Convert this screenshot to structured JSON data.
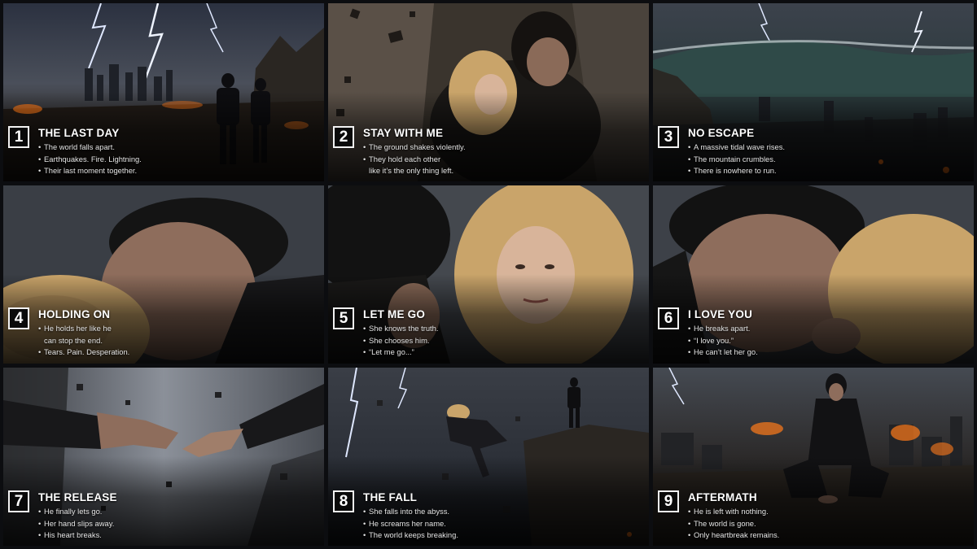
{
  "panels": [
    {
      "number": "1",
      "title": "THE LAST DAY",
      "lines": [
        {
          "text": "The world falls apart.",
          "bullet": true
        },
        {
          "text": "Earthquakes. Fire. Lightning.",
          "bullet": true
        },
        {
          "text": "Their last moment together.",
          "bullet": true
        }
      ]
    },
    {
      "number": "2",
      "title": "STAY WITH ME",
      "lines": [
        {
          "text": "The ground shakes violently.",
          "bullet": true
        },
        {
          "text": "They hold each other",
          "bullet": true
        },
        {
          "text": "like it’s the only thing left.",
          "bullet": false
        }
      ]
    },
    {
      "number": "3",
      "title": "NO ESCAPE",
      "lines": [
        {
          "text": "A massive tidal wave rises.",
          "bullet": true
        },
        {
          "text": "The mountain crumbles.",
          "bullet": true
        },
        {
          "text": "There is nowhere to run.",
          "bullet": true
        }
      ]
    },
    {
      "number": "4",
      "title": "HOLDING ON",
      "lines": [
        {
          "text": "He holds her like he",
          "bullet": true
        },
        {
          "text": "can stop the end.",
          "bullet": false
        },
        {
          "text": "Tears. Pain. Desperation.",
          "bullet": true
        }
      ]
    },
    {
      "number": "5",
      "title": "LET ME GO",
      "lines": [
        {
          "text": "She knows the truth.",
          "bullet": true
        },
        {
          "text": "She chooses him.",
          "bullet": true
        },
        {
          "text": "“Let me go...”",
          "bullet": true
        }
      ]
    },
    {
      "number": "6",
      "title": "I LOVE YOU",
      "lines": [
        {
          "text": "He breaks apart.",
          "bullet": true
        },
        {
          "text": "“I love you.”",
          "bullet": true
        },
        {
          "text": "He can’t let her go.",
          "bullet": true
        }
      ]
    },
    {
      "number": "7",
      "title": "THE RELEASE",
      "lines": [
        {
          "text": "He finally lets go.",
          "bullet": true
        },
        {
          "text": "Her hand slips away.",
          "bullet": true
        },
        {
          "text": "His heart breaks.",
          "bullet": true
        }
      ]
    },
    {
      "number": "8",
      "title": "THE FALL",
      "lines": [
        {
          "text": "She falls into the abyss.",
          "bullet": true
        },
        {
          "text": "He screams her name.",
          "bullet": true
        },
        {
          "text": "The world keeps breaking.",
          "bullet": true
        }
      ]
    },
    {
      "number": "9",
      "title": "AFTERMATH",
      "lines": [
        {
          "text": "He is left with nothing.",
          "bullet": true
        },
        {
          "text": "The world is gone.",
          "bullet": true
        },
        {
          "text": "Only heartbreak remains.",
          "bullet": true
        }
      ]
    }
  ],
  "colors": {
    "background": "#0c0d10",
    "caption_text": "#e4e4e4",
    "badge_border": "#f2f2f2",
    "fire": "#ff7a1a",
    "lightning": "#dfe8ff",
    "hair_blonde": "#c9a46a"
  }
}
